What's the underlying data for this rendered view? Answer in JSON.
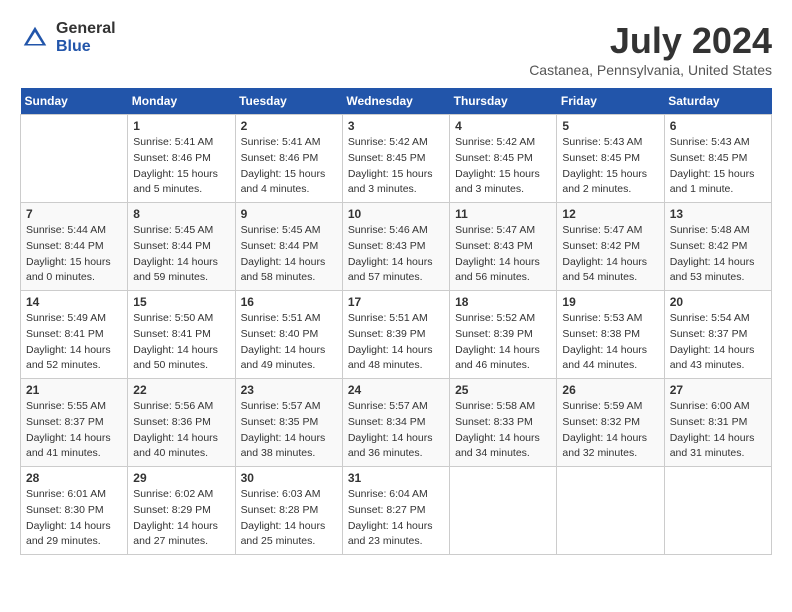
{
  "header": {
    "logo_general": "General",
    "logo_blue": "Blue",
    "title": "July 2024",
    "location": "Castanea, Pennsylvania, United States"
  },
  "days_of_week": [
    "Sunday",
    "Monday",
    "Tuesday",
    "Wednesday",
    "Thursday",
    "Friday",
    "Saturday"
  ],
  "weeks": [
    [
      {
        "day": "",
        "info": ""
      },
      {
        "day": "1",
        "info": "Sunrise: 5:41 AM\nSunset: 8:46 PM\nDaylight: 15 hours\nand 5 minutes."
      },
      {
        "day": "2",
        "info": "Sunrise: 5:41 AM\nSunset: 8:46 PM\nDaylight: 15 hours\nand 4 minutes."
      },
      {
        "day": "3",
        "info": "Sunrise: 5:42 AM\nSunset: 8:45 PM\nDaylight: 15 hours\nand 3 minutes."
      },
      {
        "day": "4",
        "info": "Sunrise: 5:42 AM\nSunset: 8:45 PM\nDaylight: 15 hours\nand 3 minutes."
      },
      {
        "day": "5",
        "info": "Sunrise: 5:43 AM\nSunset: 8:45 PM\nDaylight: 15 hours\nand 2 minutes."
      },
      {
        "day": "6",
        "info": "Sunrise: 5:43 AM\nSunset: 8:45 PM\nDaylight: 15 hours\nand 1 minute."
      }
    ],
    [
      {
        "day": "7",
        "info": "Sunrise: 5:44 AM\nSunset: 8:44 PM\nDaylight: 15 hours\nand 0 minutes."
      },
      {
        "day": "8",
        "info": "Sunrise: 5:45 AM\nSunset: 8:44 PM\nDaylight: 14 hours\nand 59 minutes."
      },
      {
        "day": "9",
        "info": "Sunrise: 5:45 AM\nSunset: 8:44 PM\nDaylight: 14 hours\nand 58 minutes."
      },
      {
        "day": "10",
        "info": "Sunrise: 5:46 AM\nSunset: 8:43 PM\nDaylight: 14 hours\nand 57 minutes."
      },
      {
        "day": "11",
        "info": "Sunrise: 5:47 AM\nSunset: 8:43 PM\nDaylight: 14 hours\nand 56 minutes."
      },
      {
        "day": "12",
        "info": "Sunrise: 5:47 AM\nSunset: 8:42 PM\nDaylight: 14 hours\nand 54 minutes."
      },
      {
        "day": "13",
        "info": "Sunrise: 5:48 AM\nSunset: 8:42 PM\nDaylight: 14 hours\nand 53 minutes."
      }
    ],
    [
      {
        "day": "14",
        "info": "Sunrise: 5:49 AM\nSunset: 8:41 PM\nDaylight: 14 hours\nand 52 minutes."
      },
      {
        "day": "15",
        "info": "Sunrise: 5:50 AM\nSunset: 8:41 PM\nDaylight: 14 hours\nand 50 minutes."
      },
      {
        "day": "16",
        "info": "Sunrise: 5:51 AM\nSunset: 8:40 PM\nDaylight: 14 hours\nand 49 minutes."
      },
      {
        "day": "17",
        "info": "Sunrise: 5:51 AM\nSunset: 8:39 PM\nDaylight: 14 hours\nand 48 minutes."
      },
      {
        "day": "18",
        "info": "Sunrise: 5:52 AM\nSunset: 8:39 PM\nDaylight: 14 hours\nand 46 minutes."
      },
      {
        "day": "19",
        "info": "Sunrise: 5:53 AM\nSunset: 8:38 PM\nDaylight: 14 hours\nand 44 minutes."
      },
      {
        "day": "20",
        "info": "Sunrise: 5:54 AM\nSunset: 8:37 PM\nDaylight: 14 hours\nand 43 minutes."
      }
    ],
    [
      {
        "day": "21",
        "info": "Sunrise: 5:55 AM\nSunset: 8:37 PM\nDaylight: 14 hours\nand 41 minutes."
      },
      {
        "day": "22",
        "info": "Sunrise: 5:56 AM\nSunset: 8:36 PM\nDaylight: 14 hours\nand 40 minutes."
      },
      {
        "day": "23",
        "info": "Sunrise: 5:57 AM\nSunset: 8:35 PM\nDaylight: 14 hours\nand 38 minutes."
      },
      {
        "day": "24",
        "info": "Sunrise: 5:57 AM\nSunset: 8:34 PM\nDaylight: 14 hours\nand 36 minutes."
      },
      {
        "day": "25",
        "info": "Sunrise: 5:58 AM\nSunset: 8:33 PM\nDaylight: 14 hours\nand 34 minutes."
      },
      {
        "day": "26",
        "info": "Sunrise: 5:59 AM\nSunset: 8:32 PM\nDaylight: 14 hours\nand 32 minutes."
      },
      {
        "day": "27",
        "info": "Sunrise: 6:00 AM\nSunset: 8:31 PM\nDaylight: 14 hours\nand 31 minutes."
      }
    ],
    [
      {
        "day": "28",
        "info": "Sunrise: 6:01 AM\nSunset: 8:30 PM\nDaylight: 14 hours\nand 29 minutes."
      },
      {
        "day": "29",
        "info": "Sunrise: 6:02 AM\nSunset: 8:29 PM\nDaylight: 14 hours\nand 27 minutes."
      },
      {
        "day": "30",
        "info": "Sunrise: 6:03 AM\nSunset: 8:28 PM\nDaylight: 14 hours\nand 25 minutes."
      },
      {
        "day": "31",
        "info": "Sunrise: 6:04 AM\nSunset: 8:27 PM\nDaylight: 14 hours\nand 23 minutes."
      },
      {
        "day": "",
        "info": ""
      },
      {
        "day": "",
        "info": ""
      },
      {
        "day": "",
        "info": ""
      }
    ]
  ]
}
